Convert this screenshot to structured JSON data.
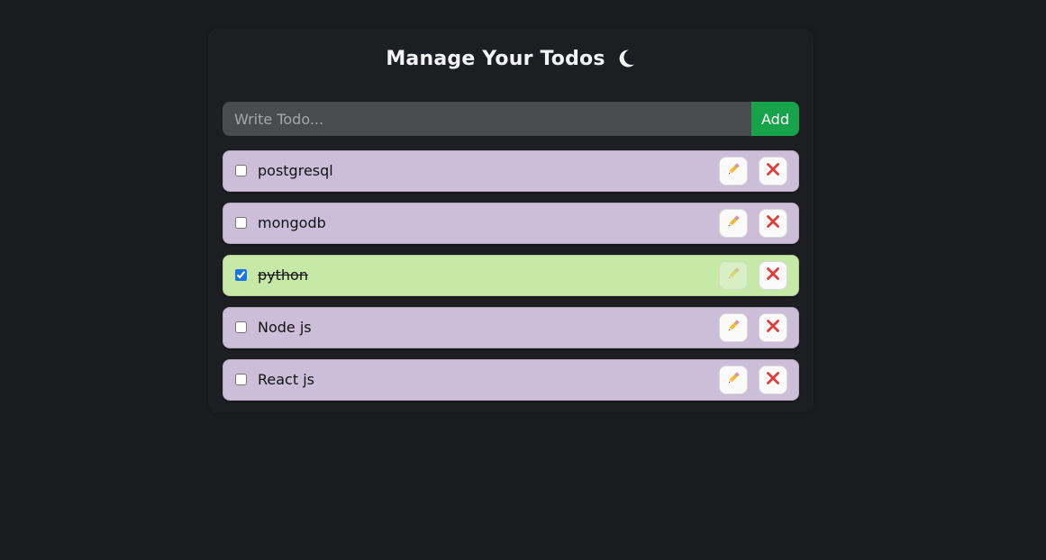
{
  "header": {
    "title": "Manage Your Todos",
    "theme_icon": "moon-icon"
  },
  "form": {
    "placeholder": "Write Todo...",
    "value": "",
    "add_label": "Add"
  },
  "colors": {
    "background": "#1a1c20",
    "todo_pending": "#ccbed8",
    "todo_done": "#c6e9a7",
    "add_button": "#16a34a",
    "delete_icon": "#e23b3b"
  },
  "todos": [
    {
      "text": "postgresql",
      "completed": false,
      "edit_icon": "pencil-icon",
      "delete_icon": "close-icon"
    },
    {
      "text": "mongodb",
      "completed": false,
      "edit_icon": "pencil-icon",
      "delete_icon": "close-icon"
    },
    {
      "text": "python",
      "completed": true,
      "edit_icon": "pencil-icon",
      "delete_icon": "close-icon"
    },
    {
      "text": "Node js",
      "completed": false,
      "edit_icon": "pencil-icon",
      "delete_icon": "close-icon"
    },
    {
      "text": "React js",
      "completed": false,
      "edit_icon": "pencil-icon",
      "delete_icon": "close-icon"
    }
  ]
}
